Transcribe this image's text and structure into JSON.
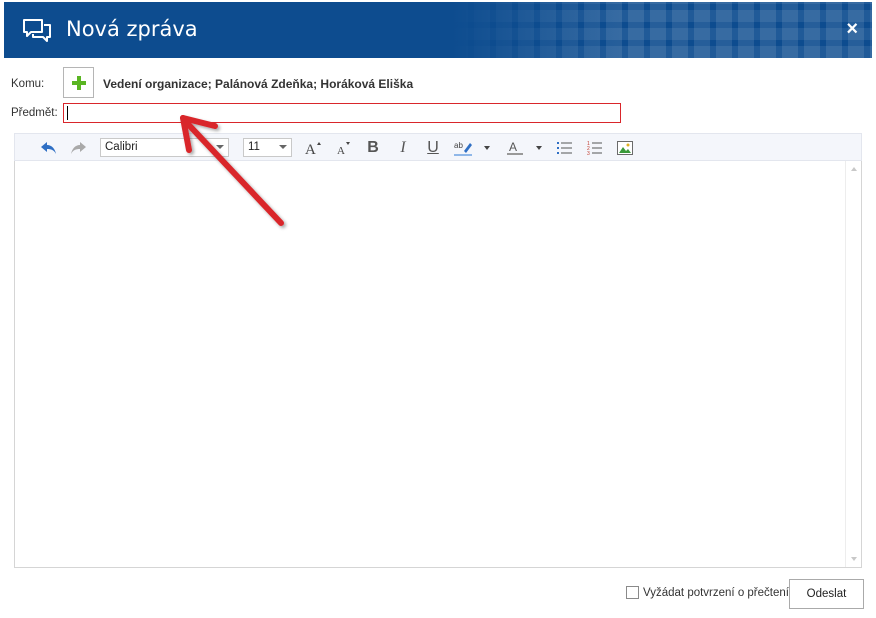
{
  "window": {
    "title": "Nová zpráva",
    "close_label": "×",
    "title_icon": "chat-bubbles-icon",
    "header_color": "#0d4c8f"
  },
  "form": {
    "to_label": "Komu:",
    "recipients": "Vedení organizace; Palánová Zdeňka; Horáková Eliška",
    "subject_label": "Předmět:",
    "subject_value": ""
  },
  "toolbar": {
    "font_family": "Calibri",
    "font_size": "11",
    "icons": [
      "undo-icon",
      "redo-icon",
      "grow-font-icon",
      "shrink-font-icon",
      "bold-icon",
      "italic-icon",
      "underline-icon",
      "highlight-icon",
      "font-color-icon",
      "bulleted-list-icon",
      "numbered-list-icon",
      "insert-image-icon"
    ],
    "bold": "B",
    "italic": "I",
    "underline": "U"
  },
  "footer": {
    "read_receipt_label": "Vyžádat potvrzení o přečtení",
    "read_receipt_checked": false,
    "send_label": "Odeslat"
  },
  "annotation": {
    "arrow_color": "#d9262b"
  }
}
